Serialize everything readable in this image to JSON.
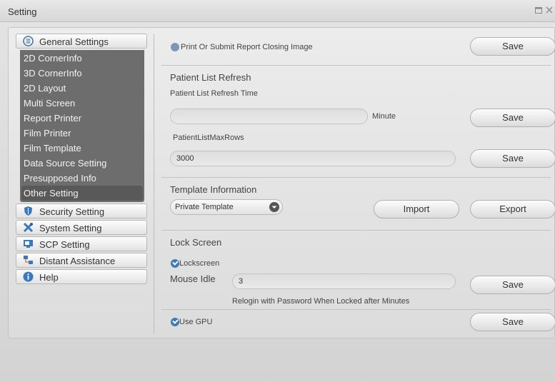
{
  "window": {
    "title": "Setting"
  },
  "sidebar": {
    "general": {
      "label": "General Settings",
      "items": [
        "2D CornerInfo",
        "3D CornerInfo",
        "2D Layout",
        "Multi Screen",
        "Report Printer",
        "Film Printer",
        "Film Template",
        "Data Source Setting",
        "Presupposed Info",
        "Other Setting"
      ],
      "active": "Other Setting"
    },
    "categories": [
      {
        "label": "Security Setting",
        "icon": "shield-icon"
      },
      {
        "label": "System Setting",
        "icon": "tools-icon"
      },
      {
        "label": "SCP Setting",
        "icon": "monitor-icon"
      },
      {
        "label": "Distant Assistance",
        "icon": "network-icon"
      },
      {
        "label": "Help",
        "icon": "info-icon"
      }
    ]
  },
  "content": {
    "print_closing": {
      "label": "Print Or Submit Report Closing Image",
      "checked": false,
      "save_label": "Save"
    },
    "patient_list": {
      "title": "Patient List Refresh",
      "refresh_time_label": "Patient List Refresh Time",
      "refresh_time_value": "",
      "unit": "Minute",
      "save_label": "Save",
      "max_rows_label": "PatientListMaxRows",
      "max_rows_value": "3000",
      "max_rows_save_label": "Save"
    },
    "template": {
      "title": "Template Information",
      "selected": "Private Template",
      "import_label": "Import",
      "export_label": "Export"
    },
    "lock_screen": {
      "title": "Lock Screen",
      "checkbox_label": "Lockscreen",
      "checked": true,
      "mouse_idle_label": "Mouse Idle",
      "mouse_idle_value": "3",
      "hint": "Relogin with Password When Locked after Minutes",
      "save_label": "Save"
    },
    "gpu": {
      "label": "Use GPU",
      "checked": true,
      "save_label": "Save"
    }
  },
  "colors": {
    "sidebar_sub_bg": "#6d6d6d",
    "checkbox_blue": "#3f79b8"
  }
}
